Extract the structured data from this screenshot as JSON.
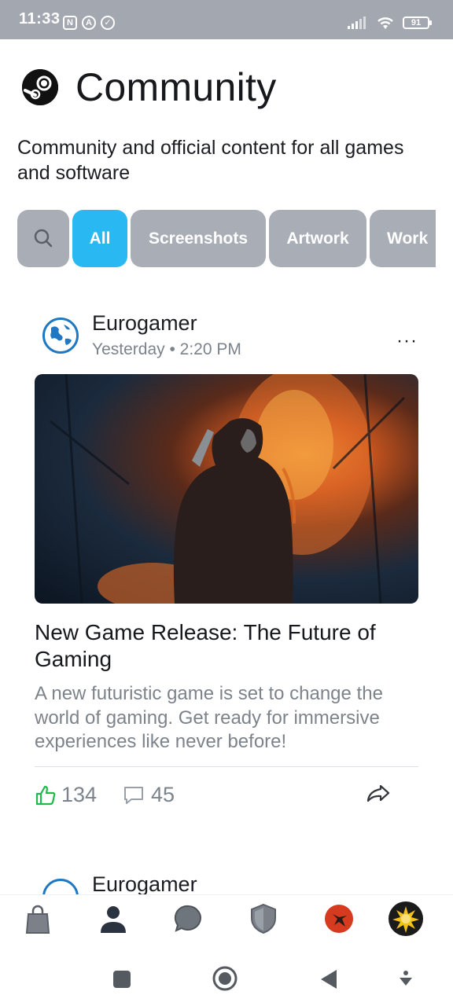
{
  "status_bar": {
    "time": "11:33",
    "battery": "91",
    "icon_nfc": "N",
    "icon_a": "A"
  },
  "header": {
    "title": "Community"
  },
  "subtitle": "Community and official content for all games and software",
  "filters": [
    "All",
    "Screenshots",
    "Artwork",
    "Work"
  ],
  "posts": [
    {
      "author": "Eurogamer",
      "time": "Yesterday • 2:20 PM",
      "more": "···",
      "title": "New Game Release: The Future of Gaming",
      "body": "A new futuristic game is set to change the world of gaming. Get ready for immersive experiences like never before!",
      "likes": "134",
      "comments": "45"
    },
    {
      "author": "Eurogamer"
    }
  ],
  "colors": {
    "accent": "#2ab8f2",
    "chip": "#a9adb6",
    "like": "#1fb84b",
    "muted": "#7c838d"
  },
  "tabs": [
    "store-icon",
    "profile-icon",
    "chat-icon",
    "guard-icon",
    "game-icon",
    "sun-icon"
  ]
}
